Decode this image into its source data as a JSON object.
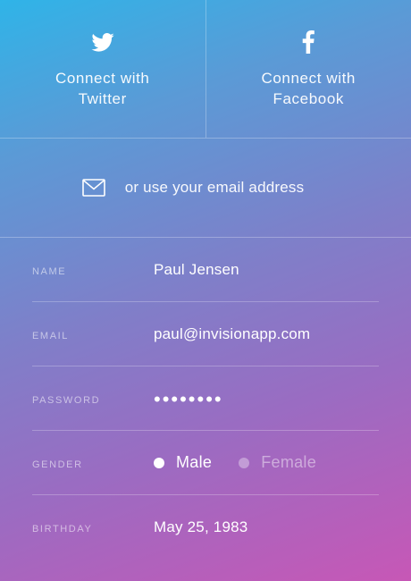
{
  "social": {
    "twitter_label": "Connect with Twitter",
    "facebook_label": "Connect with Facebook"
  },
  "email_option": {
    "label": "or use your email address"
  },
  "form": {
    "name": {
      "label": "NAME",
      "value": "Paul Jensen"
    },
    "email": {
      "label": "EMAIL",
      "value": "paul@invisionapp.com"
    },
    "password": {
      "label": "PASSWORD",
      "value": "••••••••"
    },
    "gender": {
      "label": "GENDER",
      "options": [
        "Male",
        "Female"
      ],
      "selected": "Male"
    },
    "birthday": {
      "label": "BIRTHDAY",
      "value": "May 25, 1983"
    }
  },
  "colors": {
    "gradient_top": "#2fb4e8",
    "gradient_mid": "#7f7fc9",
    "gradient_bottom": "#c757b6"
  }
}
